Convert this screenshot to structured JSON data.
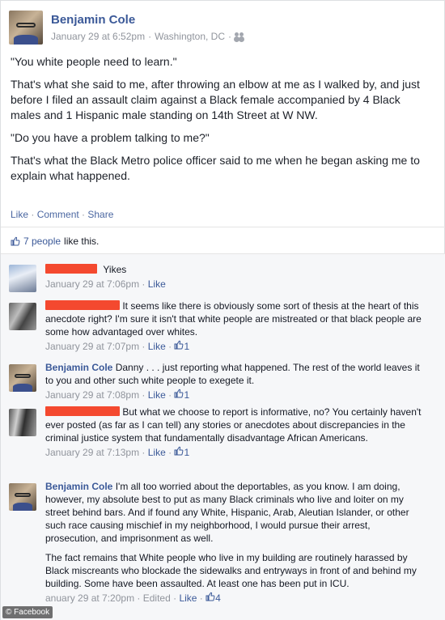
{
  "post": {
    "author": "Benjamin Cole",
    "timestamp": "January 29 at 6:52pm",
    "location": "Washington, DC",
    "audience_icon": "friends-icon",
    "paragraphs": [
      "\"You white people need to learn.\"",
      "That's what she said to me, after throwing an elbow at me as I walked by, and just before I filed an assault claim against a Black female accompanied by 4 Black males and 1 Hispanic male standing on 14th Street at W NW.",
      "\"Do you have a problem talking to me?\"",
      "That's what the Black Metro police officer said to me when he began asking me to explain what happened."
    ],
    "actions": {
      "like": "Like",
      "comment": "Comment",
      "share": "Share",
      "sep": " · "
    }
  },
  "likes_summary": {
    "people": "7 people",
    "suffix": " like this."
  },
  "comments": [
    {
      "author_redacted": true,
      "text": "Yikes",
      "time": "January 29 at 7:06pm",
      "like": "Like",
      "likes": ""
    },
    {
      "author_redacted": true,
      "text": "It seems like there is obviously some sort of thesis at the heart of this anecdote right? I'm sure it isn't that white people are mistreated or that black people are some how advantaged over whites.",
      "time": "January 29 at 7:07pm",
      "like": "Like",
      "likes": "1"
    },
    {
      "author": "Benjamin Cole",
      "text": "Danny . . . just reporting what happened. The rest of the world leaves it to you and other such white people to exegete it.",
      "time": "January 29 at 7:08pm",
      "like": "Like",
      "likes": "1"
    },
    {
      "author_redacted": true,
      "text": "But what we choose to report is informative, no? You certainly haven't ever posted (as far as I can tell) any stories or anecdotes about discrepancies in the criminal justice system that fundamentally disadvantage African Americans.",
      "time": "January 29 at 7:13pm",
      "like": "Like",
      "likes": "1"
    },
    {
      "author": "Benjamin Cole",
      "text": "I'm all too worried about the deportables, as you know. I am doing, however, my absolute best to put as many Black criminals who live and loiter on my street behind bars. And if found any White, Hispanic, Arab, Aleutian Islander, or other such race causing mischief in my neighborhood, I would pursue their arrest, prosecution, and imprisonment as well.",
      "text2": "The fact remains that White people who live in my building are routinely harassed by Black miscreants who blockade the sidewalks and entryways in front of and behind my building. Some have been assaulted. At least one has been put in ICU.",
      "time": "anuary 29 at 7:20pm",
      "edited": "Edited",
      "like": "Like",
      "likes": "4"
    }
  ],
  "meta_sep": " · ",
  "watermark": "© Facebook",
  "colors": {
    "link": "#3b5998",
    "redaction": "#f4492f",
    "meta": "#90949c"
  }
}
